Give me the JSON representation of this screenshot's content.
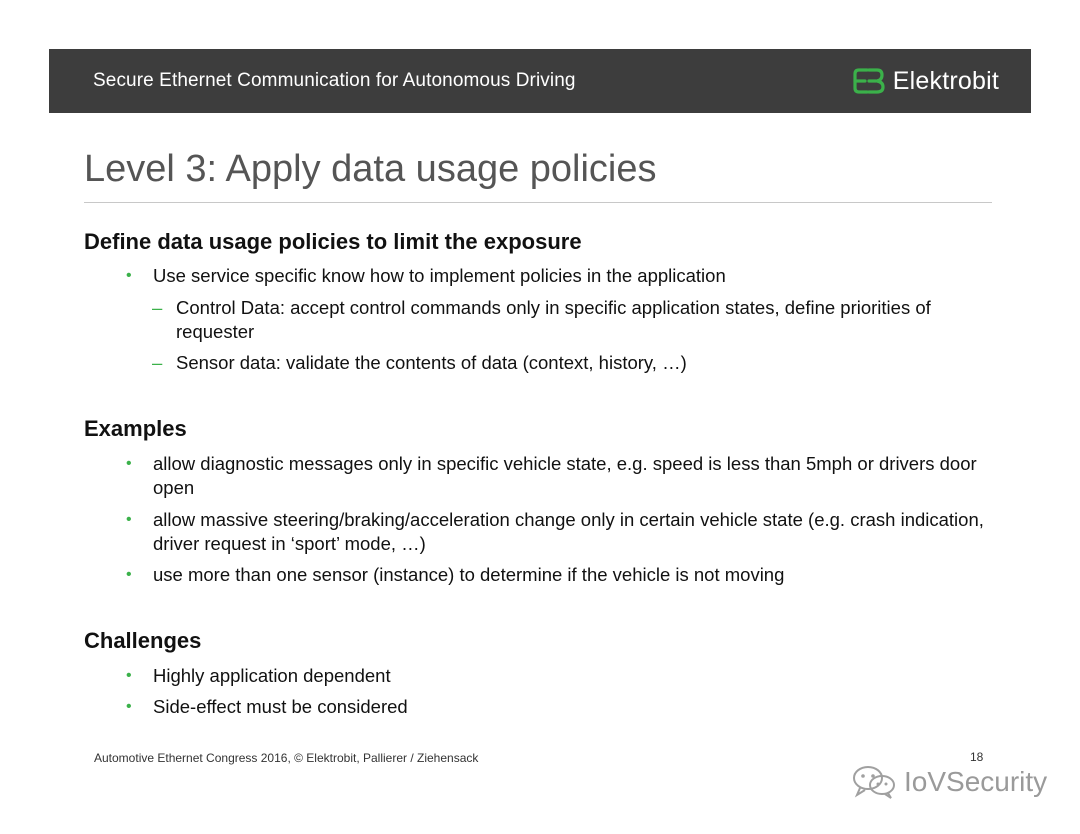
{
  "header": {
    "title": "Secure Ethernet Communication for Autonomous Driving",
    "brand": "Elektrobit",
    "bar_color": "#3d3d3d",
    "accent_color": "#3bb14a"
  },
  "slide": {
    "title": "Level 3: Apply data usage policies"
  },
  "sections": {
    "define": {
      "heading": "Define data usage policies to limit the exposure",
      "bullet1": "Use service specific know how to implement policies in the application",
      "sub1": "Control Data: accept control commands only in specific application states, define priorities of requester",
      "sub2": "Sensor data: validate the contents of data (context, history, …)"
    },
    "examples": {
      "heading": "Examples",
      "bullet1": "allow diagnostic messages only in specific vehicle state, e.g. speed is less than 5mph or drivers door open",
      "bullet2": "allow massive steering/braking/acceleration change only in certain vehicle state (e.g. crash indication, driver request in ‘sport’ mode, …)",
      "bullet3": "use more than one sensor (instance) to determine if the vehicle is not moving"
    },
    "challenges": {
      "heading": "Challenges",
      "bullet1": "Highly application dependent",
      "bullet2": "Side-effect must be considered"
    }
  },
  "footer": {
    "text": "Automotive Ethernet Congress 2016, © Elektrobit, Pallierer / Ziehensack",
    "page_number": "18"
  },
  "watermark": {
    "text": "IoVSecurity",
    "icon": "wechat-icon"
  }
}
